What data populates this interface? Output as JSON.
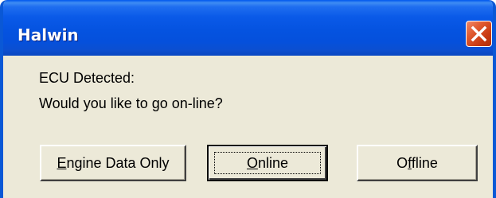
{
  "window": {
    "title": "Halwin",
    "close_icon": "close-x-icon"
  },
  "message": {
    "line1": "ECU Detected:",
    "line2": "Would you like to go on-line?"
  },
  "buttons": {
    "engine_data_only": {
      "mnemonic": "E",
      "rest": "ngine Data Only"
    },
    "online": {
      "mnemonic": "O",
      "rest": "nline"
    },
    "offline": {
      "pre": "O",
      "mnemonic": "f",
      "rest": "fline"
    }
  },
  "colors": {
    "titlebar": "#0553e0",
    "frame": "#0a58d6",
    "dialog_bg": "#ece9d8",
    "close_button": "#e05a30"
  }
}
